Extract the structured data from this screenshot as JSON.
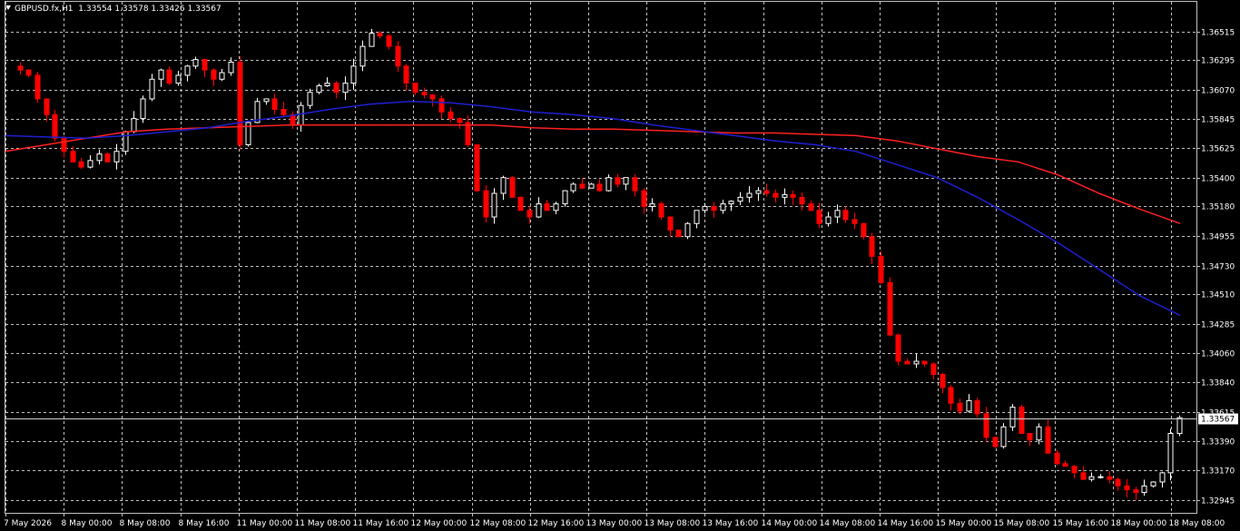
{
  "header": {
    "symbol": "GBPUSD.fx,H1",
    "ohlc": "1.33554 1.33578 1.33426 1.33567"
  },
  "colors": {
    "background": "#000000",
    "grid": "#c0c0c0",
    "bull_candle": "#ffffff",
    "bear_candle": "#ff0000",
    "ma_fast": "#ff2020",
    "ma_slow": "#1f1fd0",
    "axis_text": "#ffffff"
  },
  "chart_data": {
    "type": "candlestick",
    "title": "GBPUSD.fx,H1",
    "grid": true,
    "price_scale": {
      "min": 1.3294,
      "max": 1.3661,
      "ticks": [
        "1.36515",
        "1.36295",
        "1.36070",
        "1.35845",
        "1.35625",
        "1.35400",
        "1.35180",
        "1.34955",
        "1.34730",
        "1.34510",
        "1.34285",
        "1.34060",
        "1.33840",
        "1.33615",
        "1.33390",
        "1.33170",
        "1.32945"
      ],
      "current_price_label": "1.33567",
      "current_price": 1.33567
    },
    "time_labels": [
      "7 May 2026",
      "8 May 00:00",
      "8 May 08:00",
      "8 May 16:00",
      "11 May 00:00",
      "11 May 08:00",
      "11 May 16:00",
      "12 May 00:00",
      "12 May 08:00",
      "12 May 16:00",
      "13 May 00:00",
      "13 May 08:00",
      "13 May 16:00",
      "14 May 00:00",
      "14 May 08:00",
      "14 May 16:00",
      "15 May 00:00",
      "15 May 08:00",
      "15 May 16:00",
      "18 May 00:00",
      "18 May 08:00"
    ],
    "close_path": [
      1.3625,
      1.3622,
      1.3618,
      1.36,
      1.3588,
      1.357,
      1.356,
      1.3552,
      1.3548,
      1.3553,
      1.3558,
      1.3552,
      1.356,
      1.3575,
      1.3585,
      1.36,
      1.3615,
      1.3622,
      1.3612,
      1.3618,
      1.3625,
      1.363,
      1.3622,
      1.3615,
      1.362,
      1.3628,
      1.3565,
      1.3582,
      1.3598,
      1.36,
      1.3592,
      1.3588,
      1.358,
      1.3595,
      1.3605,
      1.361,
      1.3612,
      1.3605,
      1.3612,
      1.3625,
      1.364,
      1.365,
      1.3648,
      1.364,
      1.3625,
      1.3612,
      1.3605,
      1.3603,
      1.36,
      1.359,
      1.3585,
      1.3582,
      1.3565,
      1.353,
      1.351,
      1.3528,
      1.354,
      1.3525,
      1.3515,
      1.351,
      1.352,
      1.3515,
      1.352,
      1.353,
      1.3535,
      1.3532,
      1.3535,
      1.353,
      1.354,
      1.3535,
      1.354,
      1.353,
      1.3518,
      1.352,
      1.351,
      1.35,
      1.3495,
      1.3505,
      1.3515,
      1.3518,
      1.3515,
      1.352,
      1.3522,
      1.3525,
      1.3528,
      1.353,
      1.3528,
      1.3525,
      1.3527,
      1.3525,
      1.352,
      1.3515,
      1.3505,
      1.351,
      1.3515,
      1.3508,
      1.3505,
      1.3495,
      1.348,
      1.346,
      1.342,
      1.34,
      1.3398,
      1.34,
      1.3398,
      1.339,
      1.338,
      1.3368,
      1.3362,
      1.337,
      1.336,
      1.3342,
      1.3335,
      1.335,
      1.3365,
      1.3345,
      1.334,
      1.335,
      1.333,
      1.3322,
      1.332,
      1.3315,
      1.331,
      1.3312,
      1.3312,
      1.331,
      1.3305,
      1.3302,
      1.33,
      1.3305,
      1.3308,
      1.3315,
      1.3345,
      1.3357
    ],
    "series": [
      {
        "name": "MA fast",
        "values": [
          1.356,
          1.3565,
          1.357,
          1.3575,
          1.3577,
          1.3578,
          1.3579,
          1.358,
          1.358,
          1.358,
          1.358,
          1.358,
          1.358,
          1.3578,
          1.3577,
          1.3577,
          1.3576,
          1.3575,
          1.3574,
          1.3574,
          1.3573,
          1.3572,
          1.3568,
          1.3562,
          1.3556,
          1.3552,
          1.3542,
          1.3528,
          1.3516,
          1.3505
        ]
      },
      {
        "name": "MA slow",
        "values": [
          1.3572,
          1.3571,
          1.357,
          1.3572,
          1.3575,
          1.3578,
          1.3583,
          1.3587,
          1.3592,
          1.3596,
          1.3598,
          1.3597,
          1.3594,
          1.359,
          1.3588,
          1.3585,
          1.358,
          1.3576,
          1.3572,
          1.3568,
          1.3565,
          1.356,
          1.355,
          1.354,
          1.3525,
          1.3508,
          1.349,
          1.347,
          1.345,
          1.3435
        ]
      }
    ]
  }
}
